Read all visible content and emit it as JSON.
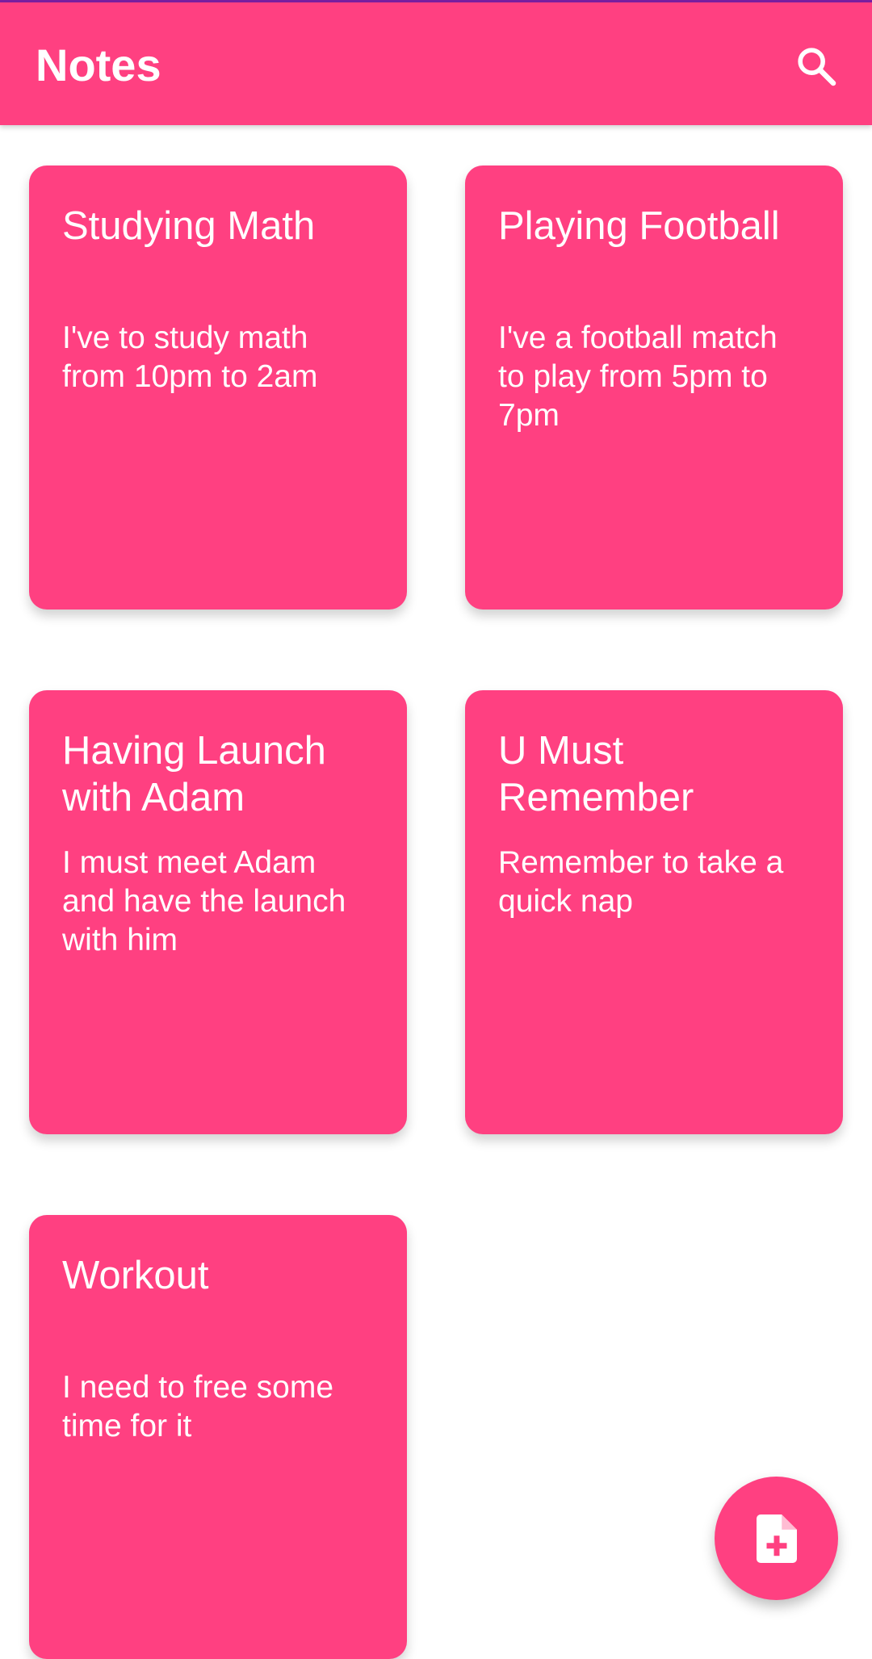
{
  "app": {
    "title": "Notes",
    "icons": {
      "search": "search-icon",
      "add_note": "note-add-icon"
    },
    "colors": {
      "accent": "#ff4081",
      "status_line": "#7b1fa2",
      "text_on_accent": "#ffffff"
    }
  },
  "notes": [
    {
      "title": "Studying Math",
      "body": "I've to study math from 10pm to 2am"
    },
    {
      "title": "Playing Football",
      "body": "I've a football match to play from 5pm to 7pm"
    },
    {
      "title": "Having Launch with Adam",
      "body": "I must meet Adam and have the launch with him"
    },
    {
      "title": "U Must Remember",
      "body": "Remember to take a quick nap"
    },
    {
      "title": "Workout",
      "body": "I need to free some time for it"
    }
  ]
}
